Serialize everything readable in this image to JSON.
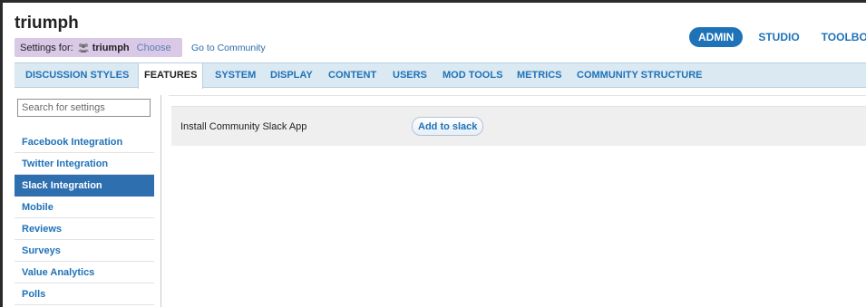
{
  "site": {
    "title": "triumph"
  },
  "settings_for": {
    "label": "Settings for:",
    "icon": "group-icon",
    "community": "triumph",
    "choose_label": "Choose",
    "go_community_label": "Go to Community"
  },
  "top_nav": {
    "admin": "ADMIN",
    "studio": "STUDIO",
    "toolbox": "TOOLBOX"
  },
  "tabs": [
    {
      "label": "DISCUSSION STYLES"
    },
    {
      "label": "FEATURES",
      "active": true
    },
    {
      "label": "SYSTEM"
    },
    {
      "label": "DISPLAY"
    },
    {
      "label": "CONTENT"
    },
    {
      "label": "USERS"
    },
    {
      "label": "MOD TOOLS"
    },
    {
      "label": "METRICS"
    },
    {
      "label": "COMMUNITY STRUCTURE"
    }
  ],
  "search": {
    "placeholder": "Search for settings"
  },
  "sidebar": {
    "items": [
      {
        "label": "Facebook Integration"
      },
      {
        "label": "Twitter Integration"
      },
      {
        "label": "Slack Integration",
        "selected": true
      },
      {
        "label": "Mobile"
      },
      {
        "label": "Reviews"
      },
      {
        "label": "Surveys"
      },
      {
        "label": "Value Analytics"
      },
      {
        "label": "Polls"
      }
    ]
  },
  "content": {
    "setting_label": "Install Community Slack App",
    "button_label": "Add to slack"
  },
  "colors": {
    "accent": "#1e72b8",
    "tab_bar": "#dbe9f3",
    "settings_badge": "#d9c8e6",
    "selected": "#2e6fb0"
  }
}
